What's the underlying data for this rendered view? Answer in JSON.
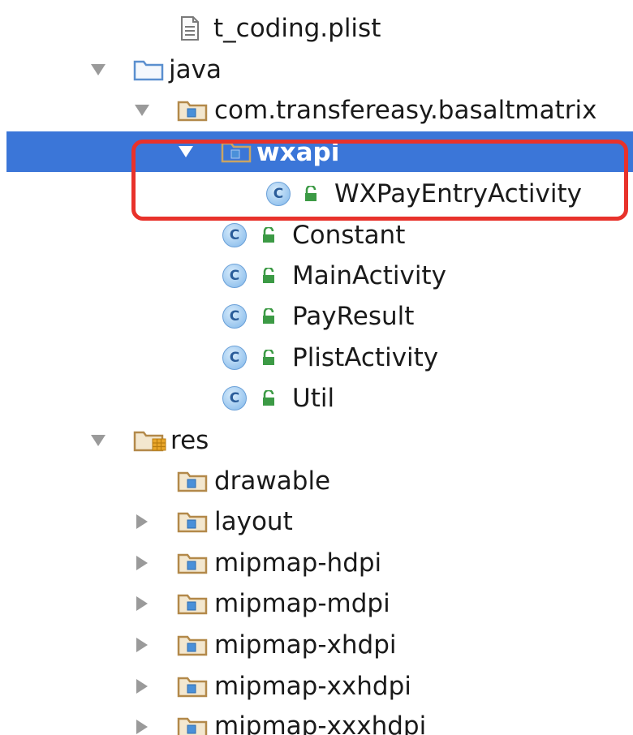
{
  "tree": {
    "items": [
      {
        "label": "t_coding.plist",
        "icon": "plist-file-icon"
      },
      {
        "label": "java",
        "icon": "folder-icon"
      },
      {
        "label": "com.transfereasy.basaltmatrix",
        "icon": "package-icon"
      },
      {
        "label": "wxapi",
        "icon": "package-icon",
        "selected": true
      },
      {
        "label": "WXPayEntryActivity",
        "icon": "class-icon"
      },
      {
        "label": "Constant",
        "icon": "class-icon"
      },
      {
        "label": "MainActivity",
        "icon": "class-icon"
      },
      {
        "label": "PayResult",
        "icon": "class-icon"
      },
      {
        "label": "PlistActivity",
        "icon": "class-icon"
      },
      {
        "label": "Util",
        "icon": "class-icon"
      },
      {
        "label": "res",
        "icon": "res-folder-icon"
      },
      {
        "label": "drawable",
        "icon": "folder-icon"
      },
      {
        "label": "layout",
        "icon": "folder-icon"
      },
      {
        "label": "mipmap-hdpi",
        "icon": "folder-icon"
      },
      {
        "label": "mipmap-mdpi",
        "icon": "folder-icon"
      },
      {
        "label": "mipmap-xhdpi",
        "icon": "folder-icon"
      },
      {
        "label": "mipmap-xxhdpi",
        "icon": "folder-icon"
      },
      {
        "label": "mipmap-xxxhdpi",
        "icon": "folder-icon"
      }
    ],
    "class_badge_letter": "C"
  },
  "colors": {
    "selection": "#3b76d8",
    "highlight_border": "#e8322b",
    "folder": "#b3894a",
    "package_dot": "#4a90d9",
    "lock": "#3c9a45"
  }
}
